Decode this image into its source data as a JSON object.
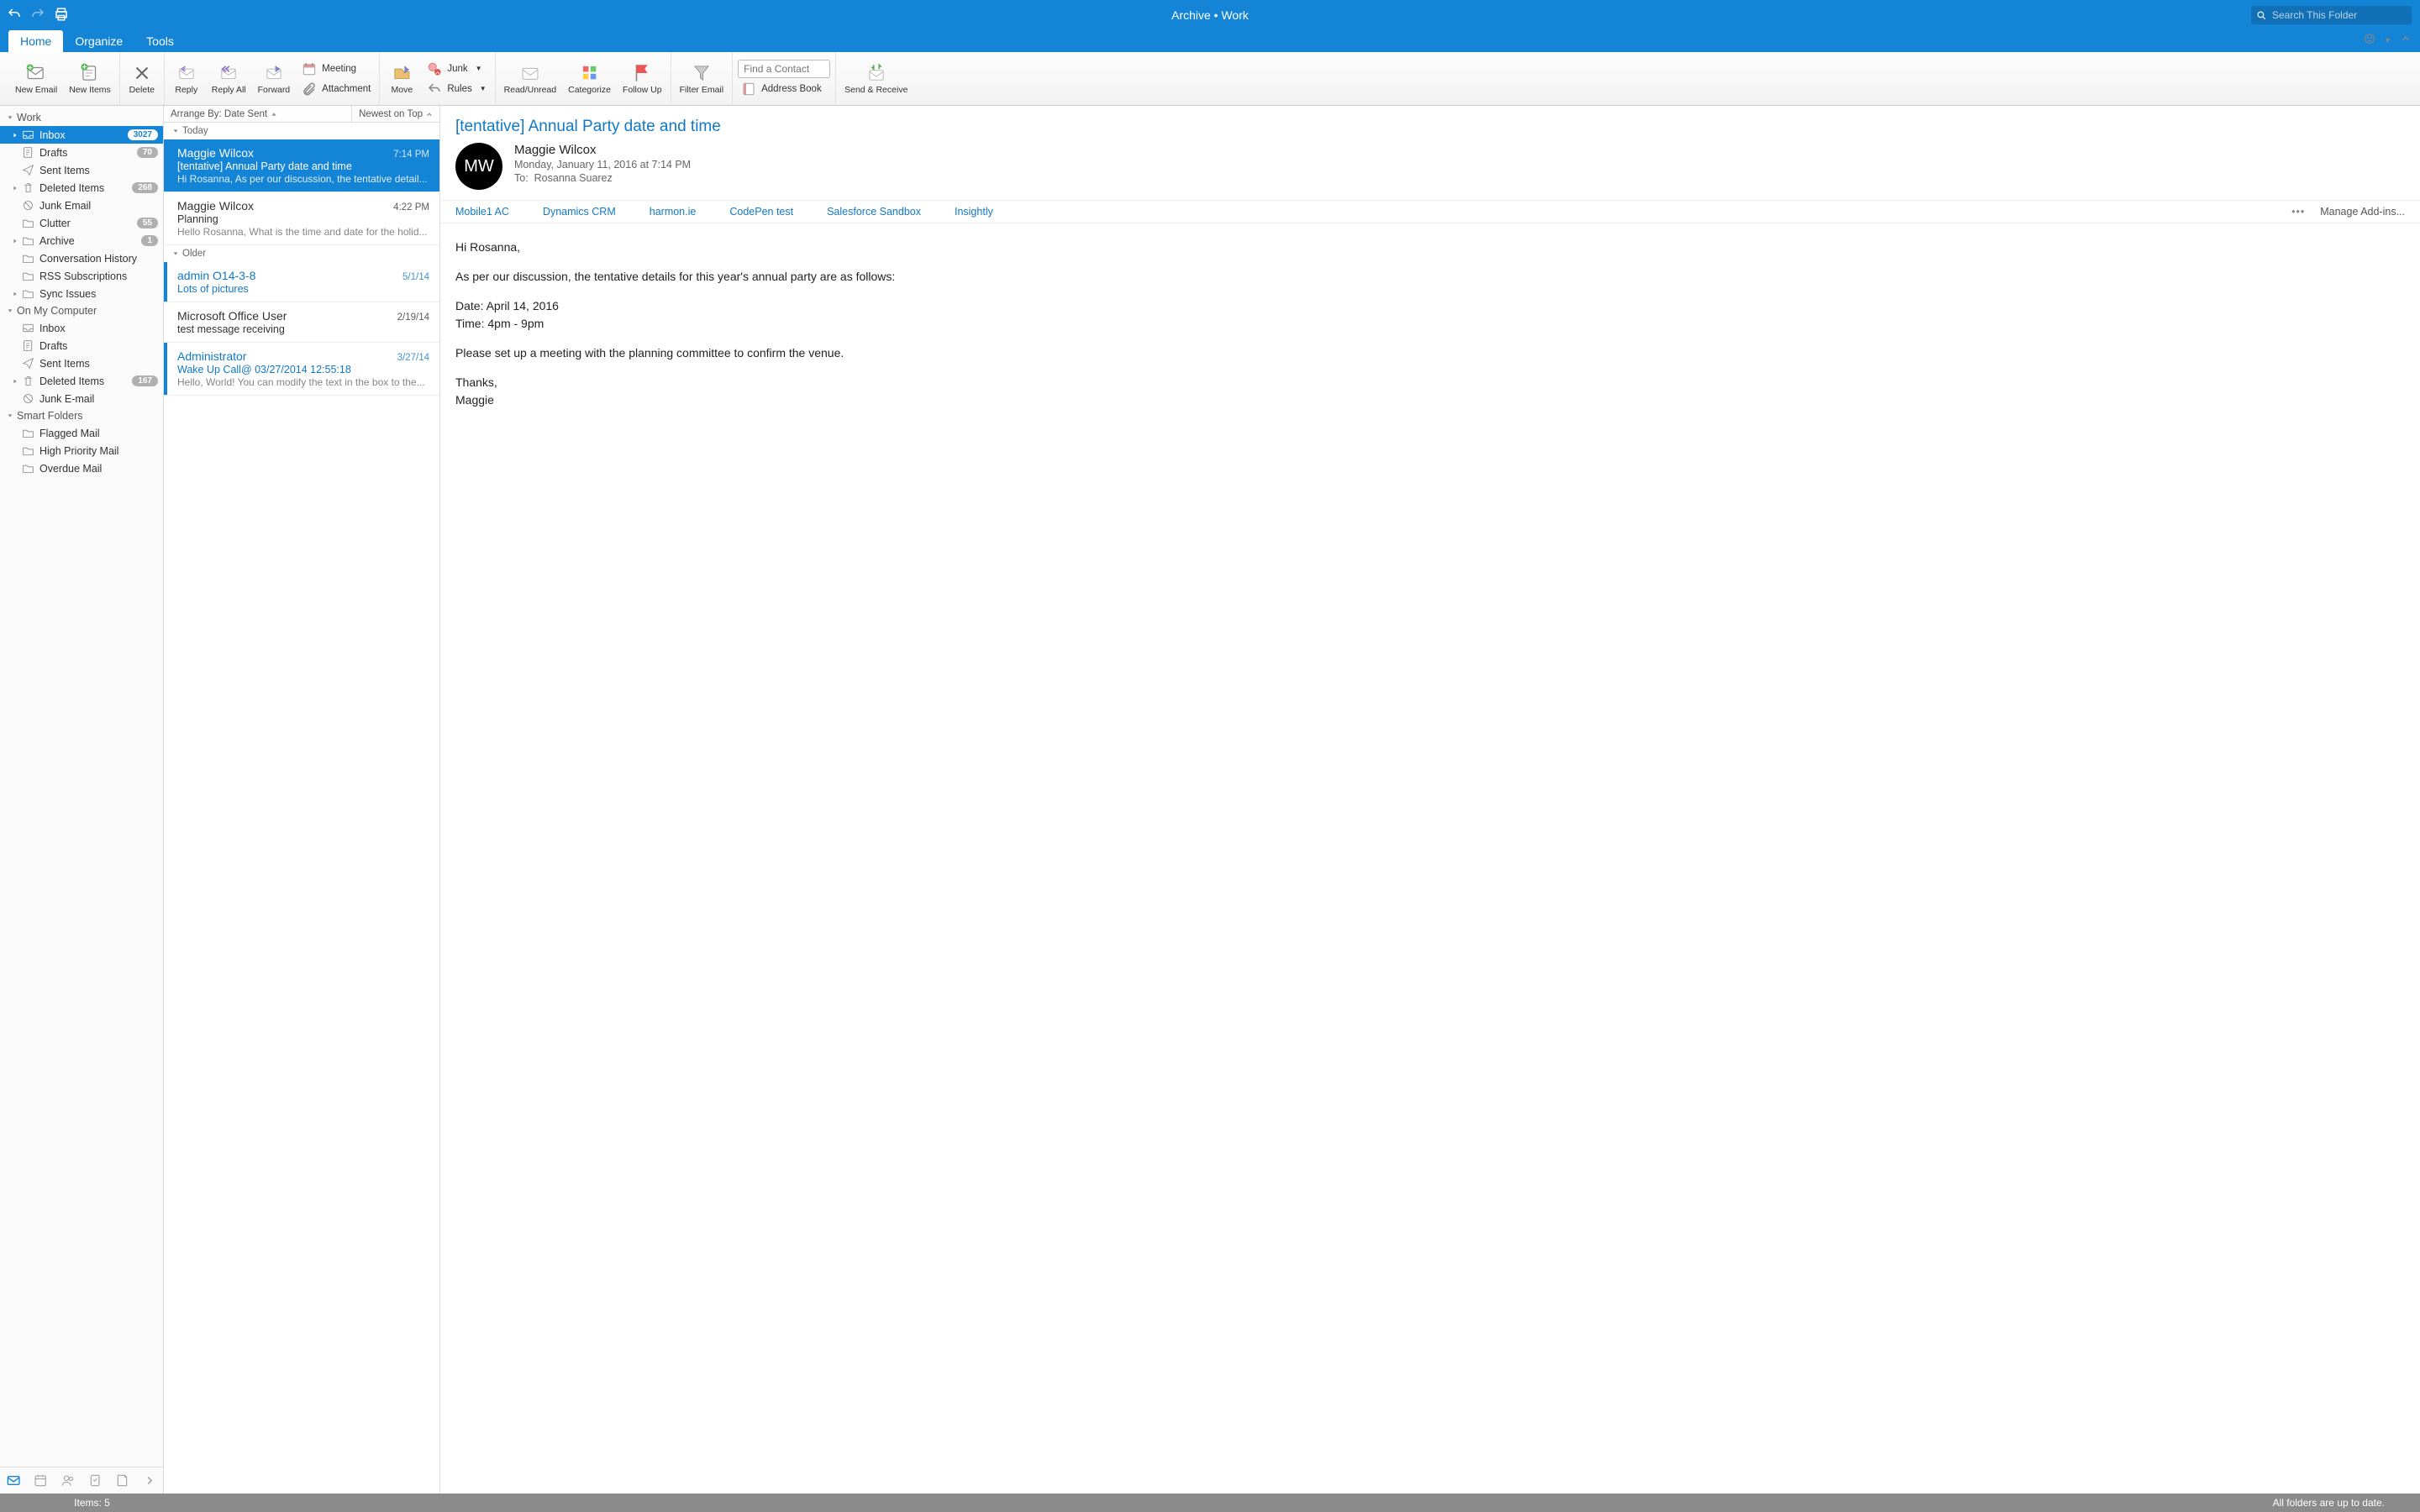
{
  "titlebar": {
    "title": "Archive • Work",
    "search_placeholder": "Search This Folder"
  },
  "tabs": {
    "items": [
      "Home",
      "Organize",
      "Tools"
    ],
    "active": 0
  },
  "ribbon": {
    "new_email": "New Email",
    "new_items": "New Items",
    "delete": "Delete",
    "reply": "Reply",
    "reply_all": "Reply All",
    "forward": "Forward",
    "meeting": "Meeting",
    "attachment": "Attachment",
    "move": "Move",
    "junk": "Junk",
    "rules": "Rules",
    "read_unread": "Read/Unread",
    "categorize": "Categorize",
    "follow_up": "Follow Up",
    "filter_email": "Filter Email",
    "find_contact_placeholder": "Find a Contact",
    "address_book": "Address Book",
    "send_receive": "Send & Receive"
  },
  "sidebar": {
    "sections": [
      {
        "label": "Work",
        "expanded": true,
        "items": [
          {
            "label": "Inbox",
            "icon": "inbox",
            "active": true,
            "expandable": true,
            "badge": "3027"
          },
          {
            "label": "Drafts",
            "icon": "drafts",
            "badge": "70"
          },
          {
            "label": "Sent Items",
            "icon": "sent"
          },
          {
            "label": "Deleted Items",
            "icon": "trash",
            "expandable": true,
            "badge": "268"
          },
          {
            "label": "Junk Email",
            "icon": "junk"
          },
          {
            "label": "Clutter",
            "icon": "folder",
            "badge": "55"
          },
          {
            "label": "Archive",
            "icon": "folder",
            "expandable": true,
            "badge": "1"
          },
          {
            "label": "Conversation History",
            "icon": "folder"
          },
          {
            "label": "RSS Subscriptions",
            "icon": "folder"
          },
          {
            "label": "Sync Issues",
            "icon": "folder",
            "expandable": true
          }
        ]
      },
      {
        "label": "On My Computer",
        "expanded": true,
        "items": [
          {
            "label": "Inbox",
            "icon": "inbox"
          },
          {
            "label": "Drafts",
            "icon": "drafts"
          },
          {
            "label": "Sent Items",
            "icon": "sent"
          },
          {
            "label": "Deleted Items",
            "icon": "trash",
            "expandable": true,
            "badge": "167"
          },
          {
            "label": "Junk E-mail",
            "icon": "junk"
          }
        ]
      },
      {
        "label": "Smart Folders",
        "expanded": true,
        "items": [
          {
            "label": "Flagged Mail",
            "icon": "folder"
          },
          {
            "label": "High Priority Mail",
            "icon": "folder"
          },
          {
            "label": "Overdue Mail",
            "icon": "folder"
          }
        ]
      }
    ]
  },
  "msglist": {
    "arrange_label": "Arrange By: Date Sent",
    "sort_label": "Newest on Top",
    "groups": [
      {
        "label": "Today",
        "messages": [
          {
            "from": "Maggie Wilcox",
            "subject": "[tentative] Annual Party date and time",
            "preview": "Hi Rosanna, As per our discussion, the tentative detail...",
            "date": "7:14 PM",
            "active": true
          },
          {
            "from": "Maggie Wilcox",
            "subject": "Planning",
            "preview": "Hello Rosanna, What is the time and date for the holid...",
            "date": "4:22 PM"
          }
        ]
      },
      {
        "label": "Older",
        "messages": [
          {
            "from": "admin O14-3-8",
            "subject": "Lots of pictures",
            "preview": "",
            "date": "5/1/14",
            "unread": true
          },
          {
            "from": "Microsoft Office User",
            "subject": "test message receiving",
            "preview": "",
            "date": "2/19/14"
          },
          {
            "from": "Administrator",
            "subject": "Wake Up Call@ 03/27/2014 12:55:18",
            "preview": "Hello, World! You can modify the text in the box to the...",
            "date": "3/27/14",
            "unread": true
          }
        ]
      }
    ]
  },
  "reading": {
    "subject": "[tentative] Annual Party date and time",
    "avatar_initials": "MW",
    "from": "Maggie Wilcox",
    "date": "Monday, January 11, 2016 at 7:14 PM",
    "to_label": "To:",
    "to": "Rosanna Suarez",
    "addins": [
      "Mobile1 AC",
      "Dynamics CRM",
      "harmon.ie",
      "CodePen test",
      "Salesforce Sandbox",
      "Insightly"
    ],
    "manage": "Manage Add-ins...",
    "body": [
      "Hi Rosanna,",
      "As per our discussion, the tentative details for this year's annual party are as follows:",
      "Date: April 14, 2016\nTime: 4pm - 9pm",
      "Please set up a meeting with the planning committee to confirm the venue.",
      "Thanks,\nMaggie"
    ]
  },
  "status": {
    "items": "Items: 5",
    "right": "All folders are up to date."
  }
}
